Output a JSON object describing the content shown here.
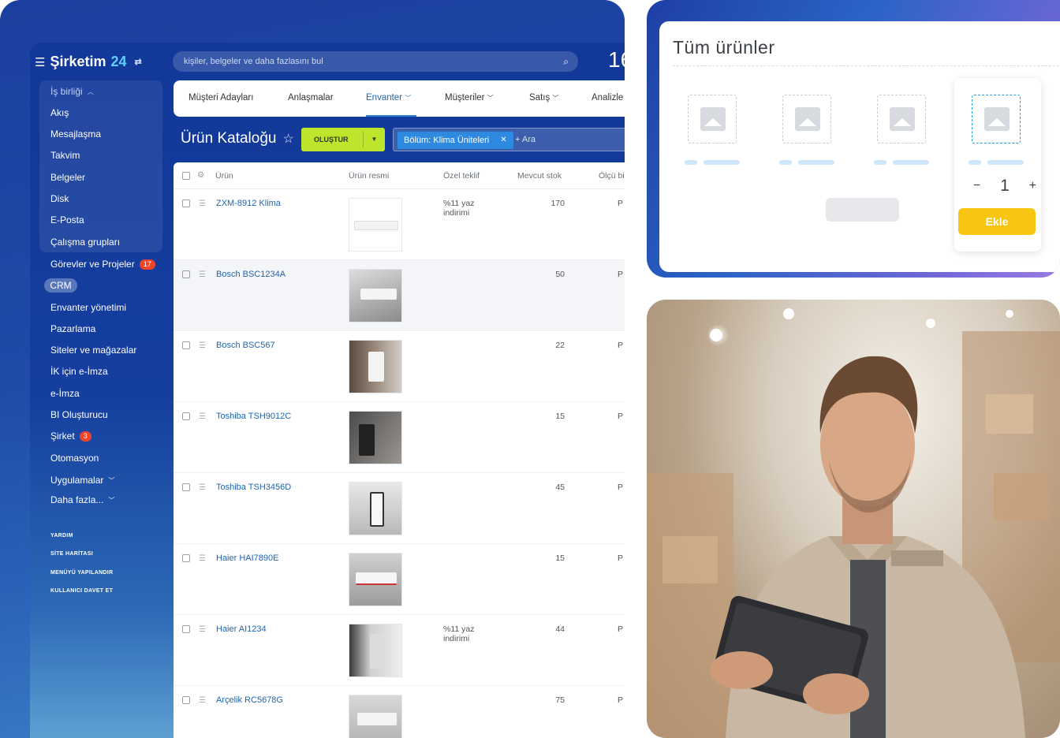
{
  "header": {
    "brand_name": "Şirketim",
    "brand_number": "24",
    "search_placeholder": "kişiler, belgeler ve daha fazlasını bul",
    "clock": "16"
  },
  "sidebar": {
    "group_label": "İş birliği",
    "items": [
      {
        "label": "Akış"
      },
      {
        "label": "Mesajlaşma"
      },
      {
        "label": "Takvim"
      },
      {
        "label": "Belgeler"
      },
      {
        "label": "Disk"
      },
      {
        "label": "E-Posta"
      },
      {
        "label": "Çalışma grupları"
      },
      {
        "label": "Görevler ve Projeler",
        "badge": "17"
      },
      {
        "label": "CRM"
      },
      {
        "label": "Envanter yönetimi"
      },
      {
        "label": "Pazarlama"
      },
      {
        "label": "Siteler ve mağazalar"
      },
      {
        "label": "İK için e-İmza"
      },
      {
        "label": "e-İmza"
      },
      {
        "label": "BI Oluşturucu"
      },
      {
        "label": "Şirket",
        "badge": "3"
      },
      {
        "label": "Otomasyon"
      },
      {
        "label": "Uygulamalar"
      },
      {
        "label": "Daha fazla..."
      }
    ],
    "footer_links": [
      "YARDIM",
      "SİTE HARİTASI",
      "MENÜYÜ YAPILANDIR",
      "KULLANICI DAVET ET"
    ]
  },
  "nav": {
    "tabs": [
      "Müşteri Adayları",
      "Anlaşmalar",
      "Envanter",
      "Müşteriler",
      "Satış",
      "Analizle"
    ],
    "active": "Envanter"
  },
  "page": {
    "title": "Ürün Kataloğu",
    "create_label": "OLUŞTUR",
    "filter_chip": "Bölüm: Klima Üniteleri",
    "search_label": "+ Ara"
  },
  "grid": {
    "columns": [
      "Ürün",
      "Ürün resmi",
      "Özel teklif",
      "Mevcut stok",
      "Ölçü bi"
    ],
    "rows": [
      {
        "name": "ZXM-8912 Klima",
        "offer": "%11 yaz indirimi",
        "stock": "170",
        "unit": "P"
      },
      {
        "name": "Bosch BSC1234A",
        "offer": "",
        "stock": "50",
        "unit": "P"
      },
      {
        "name": "Bosch BSC567",
        "offer": "",
        "stock": "22",
        "unit": "P"
      },
      {
        "name": "Toshiba TSH9012C",
        "offer": "",
        "stock": "15",
        "unit": "P"
      },
      {
        "name": "Toshiba TSH3456D",
        "offer": "",
        "stock": "45",
        "unit": "P"
      },
      {
        "name": "Haier HAI7890E",
        "offer": "",
        "stock": "15",
        "unit": "P"
      },
      {
        "name": "Haier AI1234",
        "offer": "%11 yaz indirimi",
        "stock": "44",
        "unit": "P"
      },
      {
        "name": "Arçelik RC5678G",
        "offer": "",
        "stock": "75",
        "unit": "P"
      }
    ]
  },
  "catalog_card": {
    "title": "Tüm ürünler",
    "quantity": "1",
    "minus": "−",
    "plus": "+",
    "add_label": "Ekle"
  },
  "colors": {
    "accent_blue": "#2066b0",
    "create_green": "#bde52c",
    "add_yellow": "#f8c513",
    "badge_red": "#f0442b"
  }
}
